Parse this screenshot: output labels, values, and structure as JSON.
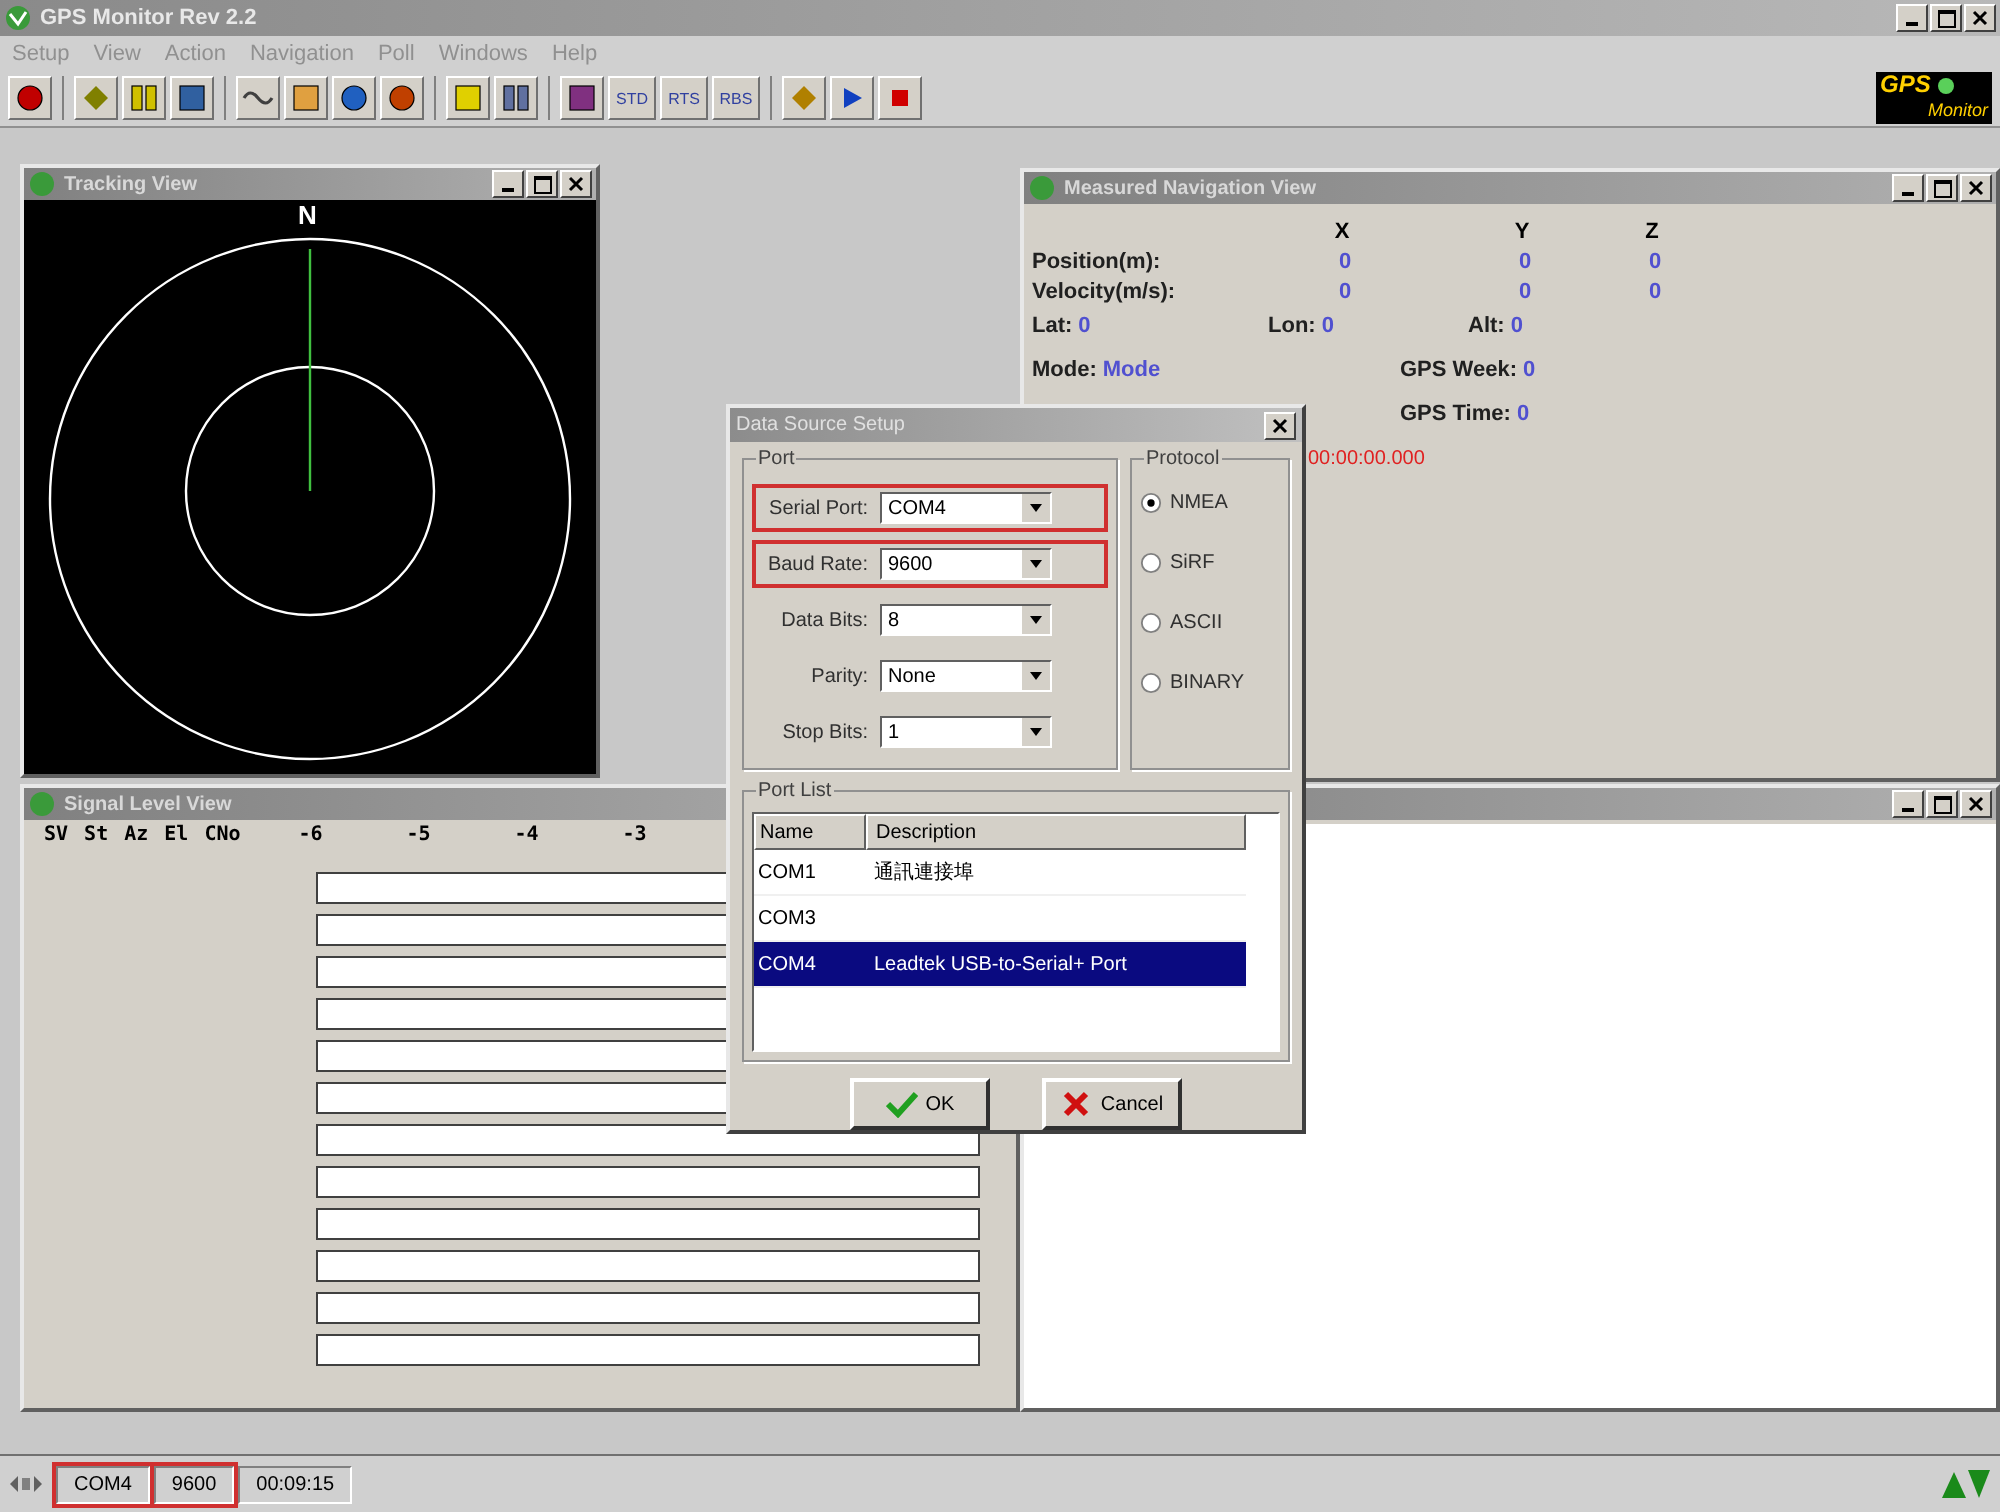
{
  "window": {
    "title": "GPS Monitor Rev 2.2"
  },
  "menu": [
    "Setup",
    "View",
    "Action",
    "Navigation",
    "Poll",
    "Windows",
    "Help"
  ],
  "toolbar_groups": [
    [
      {
        "kind": "record"
      }
    ],
    [
      {
        "kind": "connect"
      },
      {
        "kind": "pause"
      },
      {
        "kind": "panel"
      }
    ],
    [
      {
        "kind": "signal"
      },
      {
        "kind": "chart"
      },
      {
        "kind": "wheel"
      },
      {
        "kind": "compass"
      }
    ],
    [
      {
        "kind": "monitor"
      },
      {
        "kind": "grid"
      }
    ],
    [
      {
        "kind": "image"
      },
      {
        "kind": "text",
        "label": "STD"
      },
      {
        "kind": "text",
        "label": "RTS"
      },
      {
        "kind": "text",
        "label": "RBS"
      }
    ],
    [
      {
        "kind": "speaker"
      },
      {
        "kind": "play"
      },
      {
        "kind": "stop"
      }
    ]
  ],
  "logo": {
    "text": "GPS",
    "subtext": "Monitor"
  },
  "tracking_view": {
    "title": "Tracking View",
    "north_label": "N"
  },
  "navigation_view": {
    "title": "Measured Navigation View",
    "axes": [
      "X",
      "Y",
      "Z"
    ],
    "rows": [
      {
        "label": "Position(m):",
        "values": [
          "0",
          "0",
          "0"
        ]
      },
      {
        "label": "Velocity(m/s):",
        "values": [
          "0",
          "0",
          "0"
        ]
      }
    ],
    "lat": {
      "label": "Lat:",
      "value": "0"
    },
    "lon": {
      "label": "Lon:",
      "value": "0"
    },
    "alt": {
      "label": "Alt:",
      "value": "0"
    },
    "mode": {
      "label": "Mode:",
      "value": "Mode"
    },
    "gps_week": {
      "label": "GPS Week:",
      "value": "0"
    },
    "gps_time": {
      "label": "GPS Time:",
      "value": "0"
    },
    "time_reading": "00:00:00.000"
  },
  "signal_view": {
    "title": "Signal Level View",
    "columns": [
      "SV",
      "St",
      "Az",
      "El",
      "CNo"
    ],
    "scale": [
      "-6",
      "-5",
      "-4",
      "-3"
    ]
  },
  "dialog": {
    "title": "Data Source Setup",
    "port_group": "Port",
    "fields": [
      {
        "label": "Serial Port:",
        "value": "COM4",
        "highlighted": true
      },
      {
        "label": "Baud Rate:",
        "value": "9600",
        "highlighted": true
      },
      {
        "label": "Data Bits:",
        "value": "8",
        "highlighted": false
      },
      {
        "label": "Parity:",
        "value": "None",
        "highlighted": false
      },
      {
        "label": "Stop Bits:",
        "value": "1",
        "highlighted": false
      }
    ],
    "protocol_group": "Protocol",
    "protocols": [
      {
        "label": "NMEA",
        "selected": true
      },
      {
        "label": "SiRF",
        "selected": false
      },
      {
        "label": "ASCII",
        "selected": false
      },
      {
        "label": "BINARY",
        "selected": false
      }
    ],
    "port_list_group": "Port List",
    "port_list_columns": [
      "Name",
      "Description"
    ],
    "ports": [
      {
        "name": "COM1",
        "description": "通訊連接埠",
        "selected": false
      },
      {
        "name": "COM3",
        "selected": false
      },
      {
        "name": "COM4",
        "description": "Leadtek USB-to-Serial+ Port",
        "selected": true
      }
    ],
    "buttons": [
      {
        "kind": "ok",
        "label": "OK"
      },
      {
        "kind": "cancel",
        "label": "Cancel"
      }
    ]
  },
  "status_bar": [
    {
      "text": "COM4",
      "highlighted": true
    },
    {
      "text": "9600",
      "highlighted": true
    },
    {
      "text": "00:09:15",
      "highlighted": false
    }
  ]
}
